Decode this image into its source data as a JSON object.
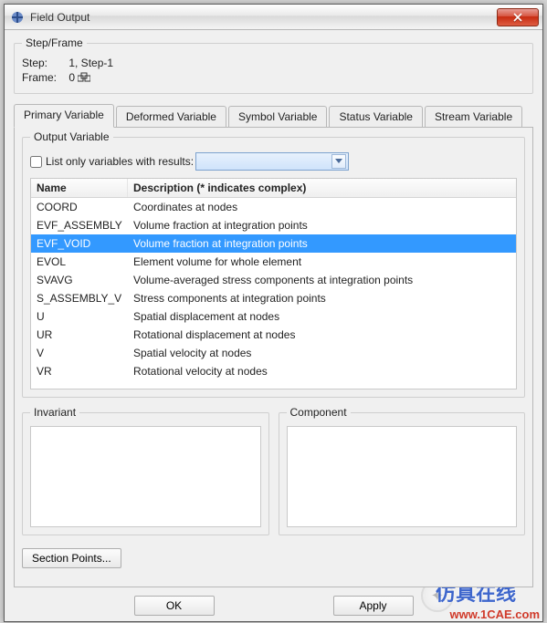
{
  "window": {
    "title": "Field Output"
  },
  "stepframe": {
    "heading": "Step/Frame",
    "step_label": "Step:",
    "step_value": "1, Step-1",
    "frame_label": "Frame:",
    "frame_value": "0"
  },
  "tabs": [
    {
      "label": "Primary Variable",
      "active": true
    },
    {
      "label": "Deformed Variable",
      "active": false
    },
    {
      "label": "Symbol Variable",
      "active": false
    },
    {
      "label": "Status Variable",
      "active": false
    },
    {
      "label": "Stream Variable",
      "active": false
    }
  ],
  "output": {
    "heading": "Output Variable",
    "checkbox_label": "List only variables with results:",
    "dropdown_value": "",
    "columns": {
      "name": "Name",
      "desc": "Description (* indicates complex)"
    },
    "rows": [
      {
        "name": "COORD",
        "desc": "Coordinates at nodes",
        "selected": false
      },
      {
        "name": "EVF_ASSEMBLY",
        "desc": "Volume fraction at integration points",
        "selected": false
      },
      {
        "name": "EVF_VOID",
        "desc": "Volume fraction at integration points",
        "selected": true
      },
      {
        "name": "EVOL",
        "desc": "Element volume for whole element",
        "selected": false
      },
      {
        "name": "SVAVG",
        "desc": "Volume-averaged stress components at integration points",
        "selected": false
      },
      {
        "name": "S_ASSEMBLY_V",
        "desc": "Stress components at integration points",
        "selected": false
      },
      {
        "name": "U",
        "desc": "Spatial displacement at nodes",
        "selected": false
      },
      {
        "name": "UR",
        "desc": "Rotational displacement at nodes",
        "selected": false
      },
      {
        "name": "V",
        "desc": "Spatial velocity at nodes",
        "selected": false
      },
      {
        "name": "VR",
        "desc": "Rotational velocity at nodes",
        "selected": false
      }
    ]
  },
  "invariant": {
    "heading": "Invariant"
  },
  "component": {
    "heading": "Component"
  },
  "section_points_btn": "Section Points...",
  "buttons": {
    "ok": "OK",
    "apply": "Apply"
  },
  "watermark": {
    "cn": "仿真在线",
    "url": "www.1CAE.com"
  }
}
